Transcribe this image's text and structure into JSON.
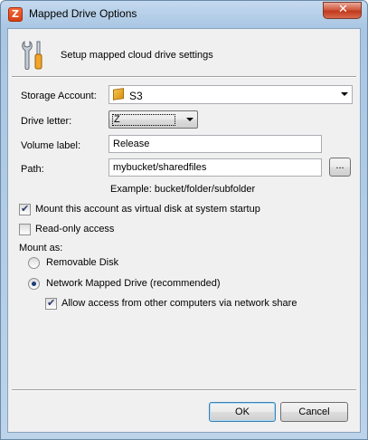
{
  "window": {
    "title": "Mapped Drive Options",
    "close_glyph": "✕"
  },
  "header": {
    "text": "Setup mapped cloud drive settings",
    "icon": "tools-icon"
  },
  "form": {
    "storage_account": {
      "label": "Storage Account:",
      "value": "S3",
      "icon": "s3-bucket-icon"
    },
    "drive_letter": {
      "label": "Drive letter:",
      "value": "Z"
    },
    "volume_label": {
      "label": "Volume label:",
      "value": "Release"
    },
    "path": {
      "label": "Path:",
      "value": "mybucket/sharedfiles",
      "browse_label": "...",
      "example": "Example: bucket/folder/subfolder"
    }
  },
  "options": {
    "mount_at_startup": {
      "label": "Mount this account as virtual disk at system startup",
      "checked": true
    },
    "read_only": {
      "label": "Read-only access",
      "checked": false
    },
    "mount_as_label": "Mount as:",
    "removable_disk": {
      "label": "Removable Disk",
      "selected": false
    },
    "network_drive": {
      "label": "Network Mapped Drive (recommended)",
      "selected": true
    },
    "allow_network_share": {
      "label": "Allow access from other computers via network share",
      "checked": true
    }
  },
  "buttons": {
    "ok": "OK",
    "cancel": "Cancel"
  },
  "colors": {
    "title_bar": "#a9c6e3",
    "close_button": "#c0391c",
    "client_bg": "#f0f0f0"
  }
}
